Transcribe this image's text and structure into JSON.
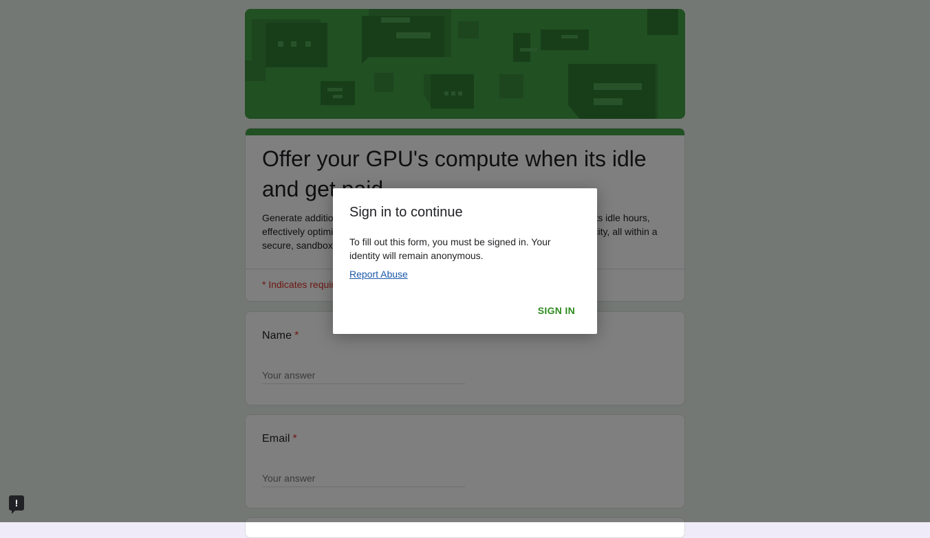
{
  "form": {
    "title": "Offer your GPU's compute when its idle and get paid",
    "description": "Generate additional income by renting out your GPU's compute power during its idle hours, effectively optimizing usage. Contribute to and make the most of unused capacity, all within a secure, sandboxed environment.",
    "required_note": "* Indicates required question"
  },
  "questions": [
    {
      "label": "Name",
      "required_mark": "*",
      "placeholder": "Your answer"
    },
    {
      "label": "Email",
      "required_mark": "*",
      "placeholder": "Your answer"
    }
  ],
  "dialog": {
    "title": "Sign in to continue",
    "body": "To fill out this form, you must be signed in. Your identity will remain anonymous.",
    "link": "Report Abuse",
    "button": "SIGN IN"
  },
  "feedback": {
    "icon": "feedback-icon",
    "glyph": "!"
  },
  "colors": {
    "accent": "#43a047",
    "required": "#d93025",
    "link": "#1a57a8",
    "sign_in": "#2e8b1f"
  }
}
